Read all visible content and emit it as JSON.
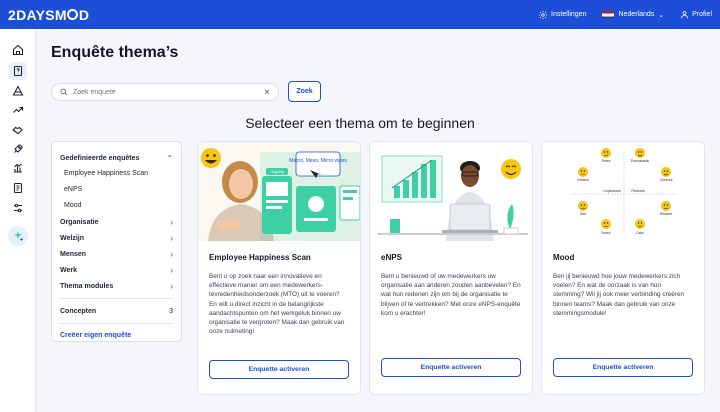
{
  "app": {
    "logo_pre": "2DAYSM",
    "logo_post": "D"
  },
  "topbar": {
    "settings_label": "Instellingen",
    "language_label": "Nederlands",
    "profile_label": "Profiel"
  },
  "page": {
    "title": "Enquête thema’s",
    "subtitle": "Selecteer een thema om te beginnen"
  },
  "search": {
    "placeholder": "Zoek enquete",
    "value": "",
    "button_label": "Zoek"
  },
  "filters": {
    "predefined_label": "Gedefinieerde enquêtes",
    "predefined_items": [
      "Employee Happiness Scan",
      "eNPS",
      "Mood"
    ],
    "categories": [
      "Organisatie",
      "Welzijn",
      "Mensen",
      "Werk",
      "Thema modules"
    ],
    "concepts_label": "Concepten",
    "concepts_count": "3",
    "create_link": "Creëer eigen enquête"
  },
  "cards": [
    {
      "title": "Employee Happiness Scan",
      "description": "Bent u op zoek naar een innovatieve en effectieve manier om een medewerkers-tevredenheidsonderzoek (MTO) uit te voeren? En wilt u direct inzicht in de belangrijkste aandachtspunten om het werkgeluk binnen uw organisatie te vergroten? Maak dan gebruik van onze nulmeting!",
      "button_label": "Enquette activeren",
      "image_labels": [
        "Macro, Meso, Micro visies",
        "Ongoing"
      ]
    },
    {
      "title": "eNPS",
      "description": "Bent u benieuwd of uw medewerkers uw organisatie aan anderen zouden aanbevelen? En wat hun redenen zijn om bij de organisatie te blijven of te vertrekken? Met onze eNPS-enquête kom u erachter!",
      "button_label": "Enquette activeren"
    },
    {
      "title": "Mood",
      "description": "Ben jij benieuwd hoe jouw medewerkers zich voelen? En wat de oorzaak is van hun stemming? Wil jij ook meer verbinding creëren binnen teams? Maak dan gebruik van onze stemmingsmodule!",
      "button_label": "Enquette activeren",
      "mood_labels": [
        "Tense",
        "Enthusiastic",
        "Irritated",
        "Cheerful",
        "Unpleasant",
        "Pleasant",
        "Sad",
        "Relaxed",
        "Bored",
        "Calm"
      ]
    }
  ],
  "colors": {
    "primary": "#1d4ed8",
    "background": "#f4f6fb",
    "accent_green": "#3ecfa4",
    "smiley": "#f5c518"
  }
}
